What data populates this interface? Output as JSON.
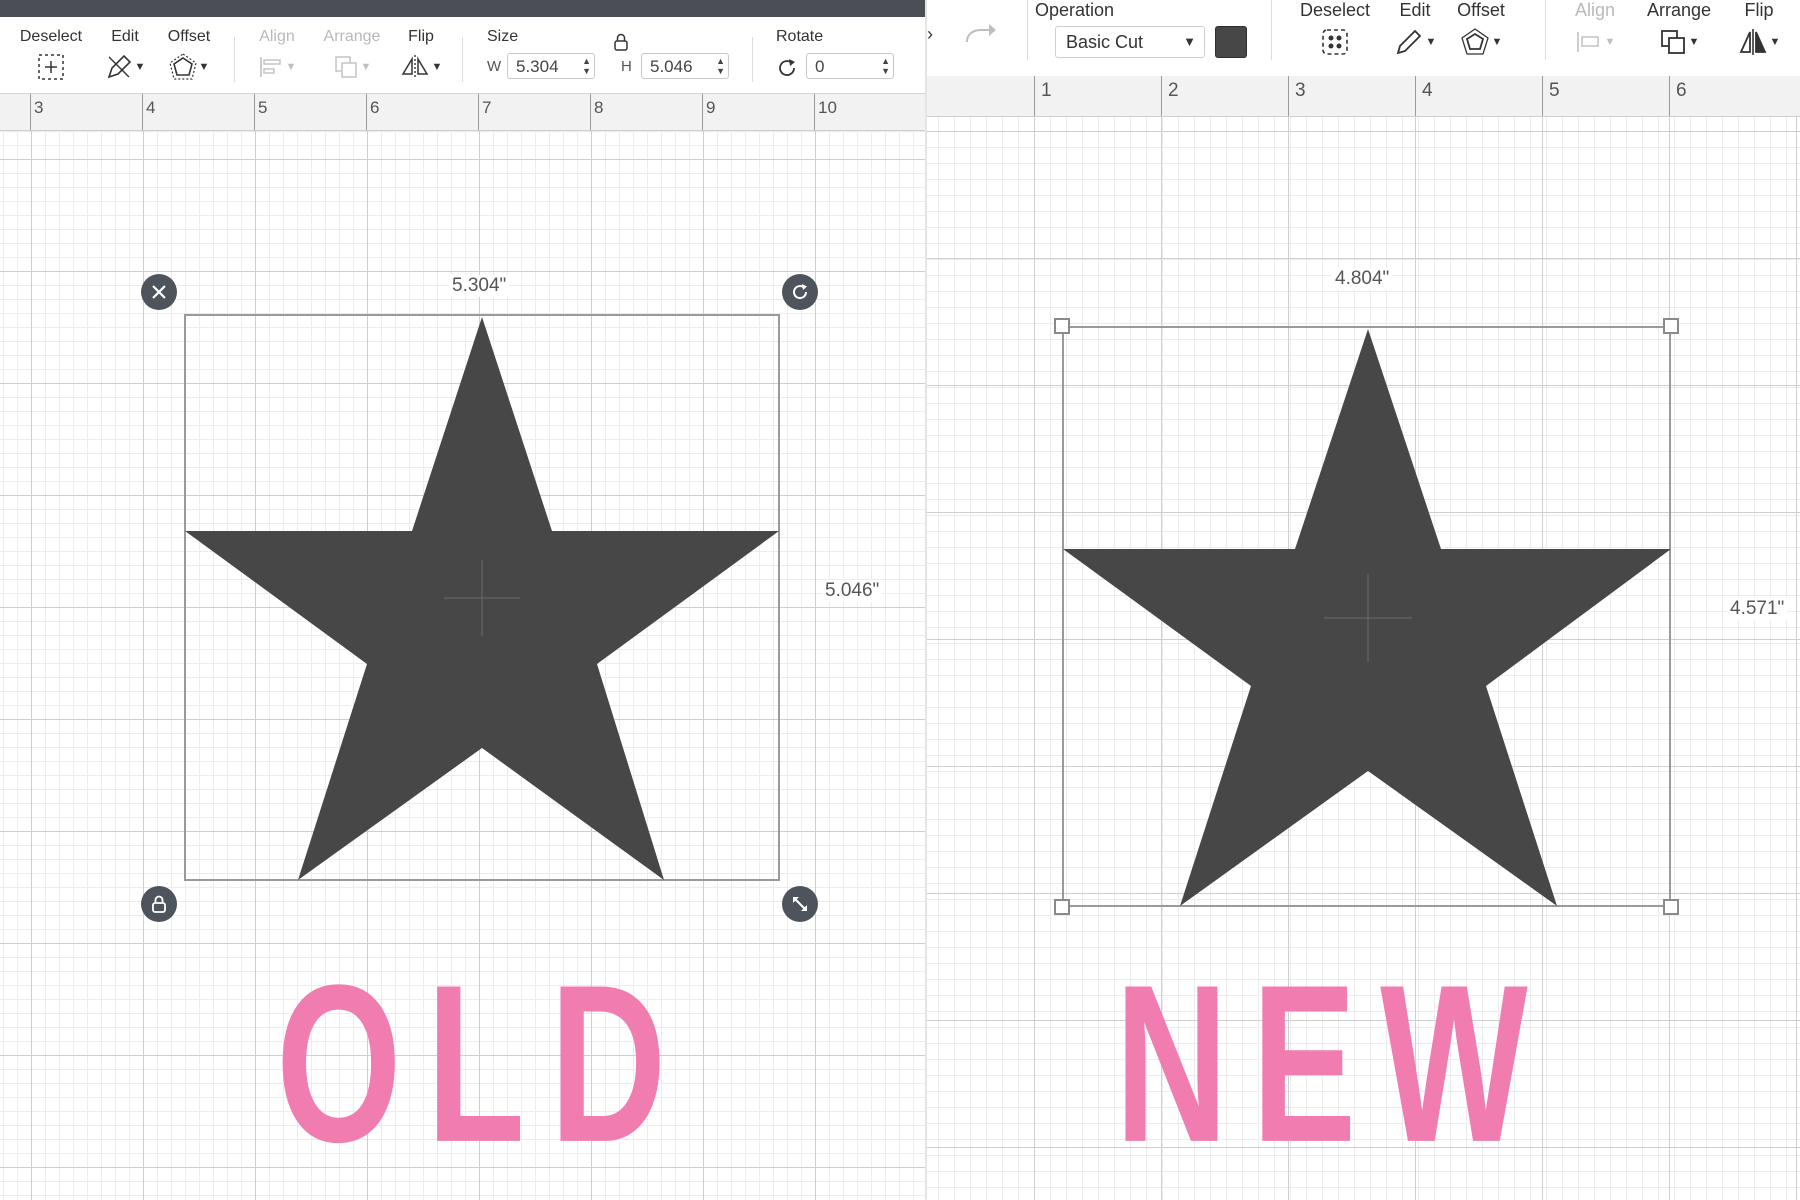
{
  "left": {
    "toolbar": {
      "deselect": "Deselect",
      "edit": "Edit",
      "offset": "Offset",
      "align": "Align",
      "arrange": "Arrange",
      "flip": "Flip",
      "size": "Size",
      "w_label": "W",
      "w_value": "5.304",
      "h_label": "H",
      "h_value": "5.046",
      "rotate": "Rotate",
      "rotate_value": "0"
    },
    "ruler": [
      "3",
      "4",
      "5",
      "6",
      "7",
      "8",
      "9",
      "10"
    ],
    "width_dim": "5.304\"",
    "height_dim": "5.046\"",
    "caption": "OLD"
  },
  "right": {
    "toolbar": {
      "operation": "Operation",
      "operation_value": "Basic Cut",
      "deselect": "Deselect",
      "edit": "Edit",
      "offset": "Offset",
      "align": "Align",
      "arrange": "Arrange",
      "flip": "Flip"
    },
    "ruler": [
      "1",
      "2",
      "3",
      "4",
      "5",
      "6"
    ],
    "width_dim": "4.804\"",
    "height_dim": "4.571\"",
    "caption": "NEW"
  },
  "colors": {
    "shape": "#474747",
    "caption": "#f07cb0",
    "handle_dark": "#4d545b"
  },
  "icons": [
    "deselect-icon",
    "edit-icon",
    "offset-icon",
    "align-icon",
    "arrange-icon",
    "flip-icon",
    "lock-icon",
    "rotate-icon",
    "redo-icon",
    "close-icon",
    "resize-icon"
  ]
}
